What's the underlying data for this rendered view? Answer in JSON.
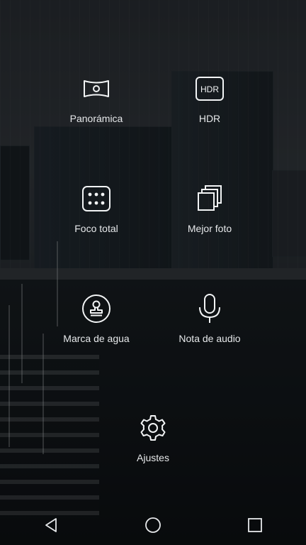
{
  "modes": {
    "panorama": {
      "label": "Panorámica",
      "icon": "panorama-icon"
    },
    "hdr": {
      "label": "HDR",
      "icon_text": "HDR",
      "icon": "hdr-icon"
    },
    "all_focus": {
      "label": "Foco total",
      "icon": "all-focus-icon"
    },
    "best_photo": {
      "label": "Mejor foto",
      "icon": "best-photo-icon"
    },
    "watermark": {
      "label": "Marca de agua",
      "icon": "watermark-stamp-icon"
    },
    "audio_note": {
      "label": "Nota de audio",
      "icon": "microphone-icon"
    },
    "settings": {
      "label": "Ajustes",
      "icon": "gear-icon"
    }
  },
  "navbar": {
    "back": "back-triangle-icon",
    "home": "home-circle-icon",
    "recents": "recents-square-icon"
  }
}
